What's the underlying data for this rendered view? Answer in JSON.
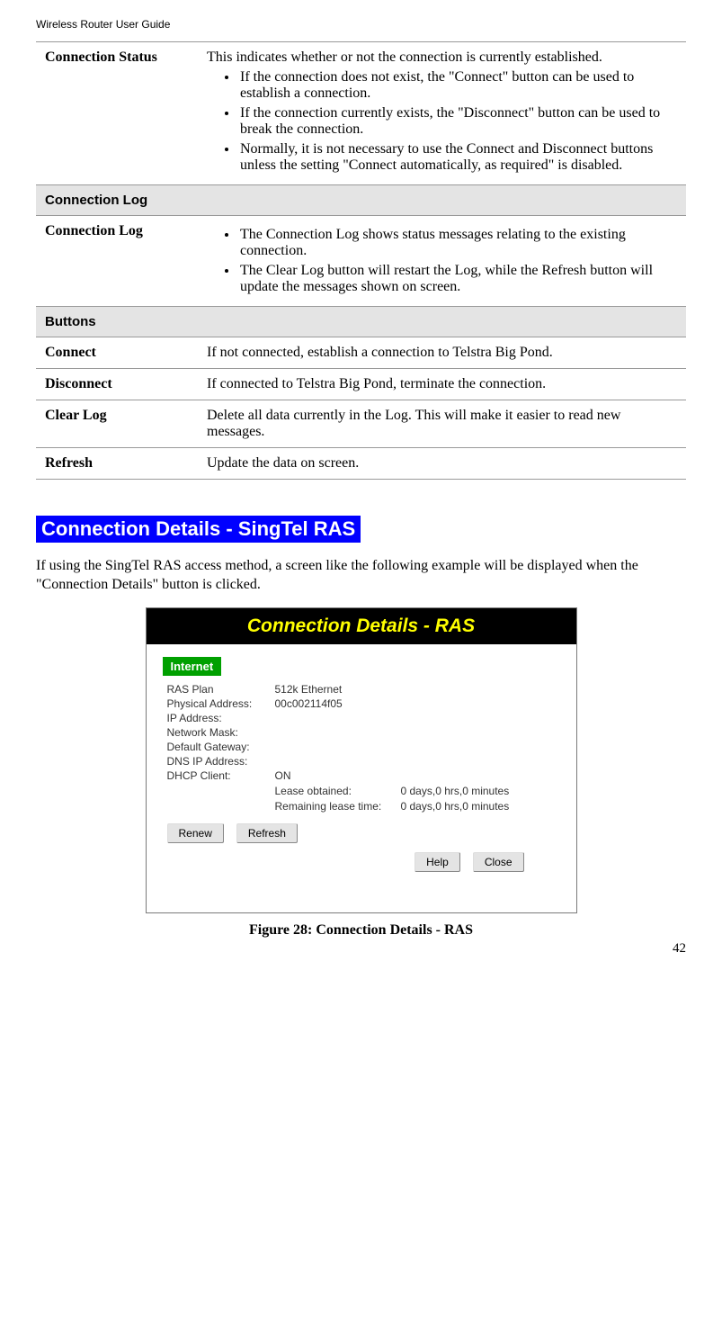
{
  "header": "Wireless Router User Guide",
  "table_rows": {
    "conn_status_label": "Connection Status",
    "conn_status_intro": "This indicates whether or not the connection is currently established.",
    "conn_status_b1": "If the connection does not exist, the \"Connect\" button can be used to establish a connection.",
    "conn_status_b2": "If the connection currently exists, the \"Disconnect\" button can be used to break the connection.",
    "conn_status_b3": "Normally, it is not necessary to use the Connect and Disconnect buttons unless the setting \"Connect automatically, as required\" is disabled.",
    "conn_log_header": "Connection Log",
    "conn_log_label": "Connection Log",
    "conn_log_b1": "The Connection Log shows status messages relating to the existing connection.",
    "conn_log_b2": "The Clear Log button will restart the Log, while the Refresh button will update the messages shown on screen.",
    "buttons_header": "Buttons",
    "connect_label": "Connect",
    "connect_desc": "If not connected, establish a connection to Telstra Big Pond.",
    "disconnect_label": "Disconnect",
    "disconnect_desc": "If connected to Telstra Big Pond, terminate the connection.",
    "clearlog_label": "Clear Log",
    "clearlog_desc": "Delete all data currently in the Log. This will make it easier to read new messages.",
    "refresh_label": "Refresh",
    "refresh_desc": "Update the data on screen."
  },
  "section_heading": "Connection Details - SingTel RAS",
  "body_text": "If using the SingTel RAS access method, a screen like the following example will be displayed when the \"Connection Details\" button is clicked.",
  "figure": {
    "title": "Connection Details - RAS",
    "internet": "Internet",
    "rows": {
      "ras_plan_label": "RAS Plan",
      "ras_plan_value": "512k Ethernet",
      "phys_addr_label": "Physical Address:",
      "phys_addr_value": "00c002114f05",
      "ip_addr_label": "IP Address:",
      "netmask_label": "Network Mask:",
      "gateway_label": "Default Gateway:",
      "dns_label": "DNS IP Address:",
      "dhcp_label": "DHCP Client:",
      "dhcp_value": "ON",
      "lease_obt_label": "Lease obtained:",
      "lease_obt_value": "0 days,0 hrs,0 minutes",
      "lease_rem_label": "Remaining lease time:",
      "lease_rem_value": "0 days,0 hrs,0 minutes"
    },
    "buttons": {
      "renew": "Renew",
      "refresh": "Refresh",
      "help": "Help",
      "close": "Close"
    }
  },
  "figure_caption": "Figure 28: Connection Details - RAS",
  "page_number": "42"
}
